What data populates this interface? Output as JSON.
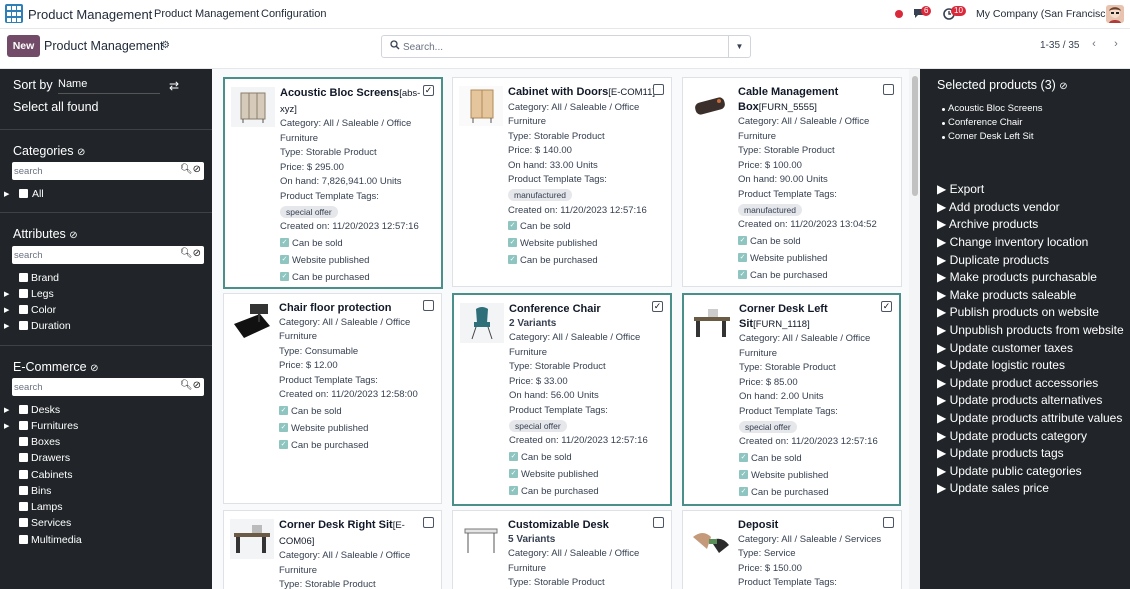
{
  "navbar": {
    "brand": "Product Management",
    "menu": [
      "Product Management",
      "Configuration"
    ],
    "messages_count": "6",
    "activities_count": "10",
    "company": "My Company (San Francisco)"
  },
  "control": {
    "new_label": "New",
    "title": "Product Management",
    "search_placeholder": "Search...",
    "pager": "1-35 / 35"
  },
  "sidebar": {
    "sort_label": "Sort by",
    "sort_value": "Name",
    "select_all": "Select all found",
    "categories": {
      "title": "Categories",
      "search_placeholder": "search",
      "items": [
        "All"
      ]
    },
    "attributes": {
      "title": "Attributes",
      "search_placeholder": "search",
      "items": [
        "Brand",
        "Legs",
        "Color",
        "Duration"
      ]
    },
    "ecommerce": {
      "title": "E-Commerce",
      "search_placeholder": "search",
      "items": [
        "Desks",
        "Furnitures",
        "Boxes",
        "Drawers",
        "Cabinets",
        "Bins",
        "Lamps",
        "Services",
        "Multimedia"
      ]
    }
  },
  "labels": {
    "can_be_sold": "Can be sold",
    "website_published": "Website published",
    "can_be_purchased": "Can be purchased",
    "tags_label": "Product Template Tags:"
  },
  "cards": [
    {
      "name": "Acoustic Bloc Screens",
      "code": "[abs-xyz]",
      "category": "Category: All / Saleable / Office Furniture",
      "type": "Type: Storable Product",
      "price": "Price: $ 295.00",
      "onhand": "On hand: 7,826,941.00 Units",
      "tag": "special offer",
      "created": "Created on: 11/20/2023 12:57:16",
      "selected": true
    },
    {
      "name": "Cabinet with Doors",
      "code": "[E-COM11]",
      "category": "Category: All / Saleable / Office Furniture",
      "type": "Type: Storable Product",
      "price": "Price: $ 140.00",
      "onhand": "On hand: 33.00 Units",
      "tag": "manufactured",
      "created": "Created on: 11/20/2023 12:57:16",
      "selected": false
    },
    {
      "name": "Cable Management Box",
      "code": "[FURN_5555]",
      "category": "Category: All / Saleable / Office Furniture",
      "type": "Type: Storable Product",
      "price": "Price: $ 100.00",
      "onhand": "On hand: 90.00 Units",
      "tag": "manufactured",
      "created": "Created on: 11/20/2023 13:04:52",
      "selected": false
    },
    {
      "name": "Chair floor protection",
      "code": "",
      "category": "Category: All / Saleable / Office Furniture",
      "type": "Type: Consumable",
      "price": "Price: $ 12.00",
      "onhand": "",
      "tag": "",
      "created": "Created on: 11/20/2023 12:58:00",
      "selected": false
    },
    {
      "name": "Conference Chair",
      "code": "",
      "variants": "2 Variants",
      "category": "Category: All / Saleable / Office Furniture",
      "type": "Type: Storable Product",
      "price": "Price: $ 33.00",
      "onhand": "On hand: 56.00 Units",
      "tag": "special offer",
      "created": "Created on: 11/20/2023 12:57:16",
      "selected": true
    },
    {
      "name": "Corner Desk Left Sit",
      "code": "[FURN_1118]",
      "category": "Category: All / Saleable / Office Furniture",
      "type": "Type: Storable Product",
      "price": "Price: $ 85.00",
      "onhand": "On hand: 2.00 Units",
      "tag": "special offer",
      "created": "Created on: 11/20/2023 12:57:16",
      "selected": true
    },
    {
      "name": "Corner Desk Right Sit",
      "code": "[E-COM06]",
      "category": "Category: All / Saleable / Office Furniture",
      "type": "Type: Storable Product",
      "selected": false
    },
    {
      "name": "Customizable Desk",
      "code": "",
      "variants": "5 Variants",
      "category": "Category: All / Saleable / Office Furniture",
      "type": "Type: Storable Product",
      "selected": false
    },
    {
      "name": "Deposit",
      "code": "",
      "category": "Category: All / Saleable / Services",
      "type": "Type: Service",
      "price": "Price: $ 150.00",
      "selected": false
    }
  ],
  "rightpanel": {
    "title": "Selected products (3)",
    "selected": [
      "Acoustic Bloc Screens",
      "Conference Chair",
      "Corner Desk Left Sit"
    ],
    "actions": [
      "Export",
      "Add products vendor",
      "Archive products",
      "Change inventory location",
      "Duplicate products",
      "Make products purchasable",
      "Make products saleable",
      "Publish products on website",
      "Unpublish products from website",
      "Update customer taxes",
      "Update logistic routes",
      "Update product accessories",
      "Update products alternatives",
      "Update products attribute values",
      "Update products category",
      "Update products tags",
      "Update public categories",
      "Update sales price"
    ]
  }
}
